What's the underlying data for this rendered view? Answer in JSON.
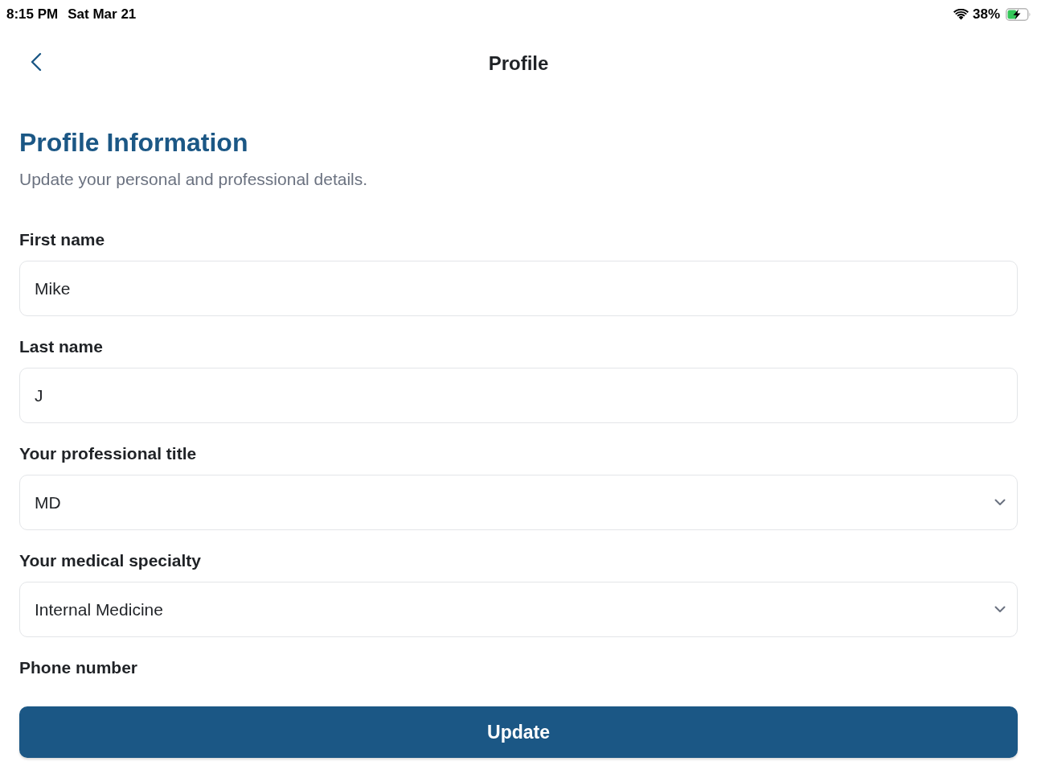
{
  "status_bar": {
    "time": "8:15 PM",
    "date": "Sat Mar 21",
    "battery": "38%",
    "charging": true
  },
  "nav": {
    "title": "Profile"
  },
  "header": {
    "title": "Profile Information",
    "subtitle": "Update your personal and professional details."
  },
  "fields": [
    {
      "label": "First name",
      "kind": "text",
      "value": "Mike"
    },
    {
      "label": "Last name",
      "kind": "text",
      "value": "J"
    },
    {
      "label": "Your professional title",
      "kind": "select",
      "value": "MD"
    },
    {
      "label": "Your medical specialty",
      "kind": "select",
      "value": "Internal Medicine"
    },
    {
      "label": "Phone number",
      "kind": "phone"
    }
  ],
  "submit_button": {
    "label": "Update"
  }
}
